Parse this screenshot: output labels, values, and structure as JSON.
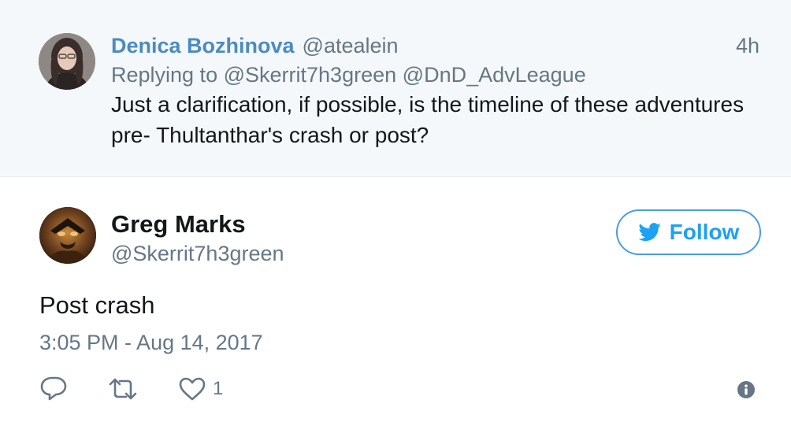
{
  "parent_tweet": {
    "author_name": "Denica Bozhinova",
    "author_handle": "@atealein",
    "time_ago": "4h",
    "replying_label": "Replying to",
    "replying_to": [
      "@Skerrit7h3green",
      "@DnD_AdvLeague"
    ],
    "text": "Just a clarification, if possible, is the timeline of these adventures pre- Thultanthar's crash or post?"
  },
  "main_tweet": {
    "author_name": "Greg Marks",
    "author_handle": "@Skerrit7h3green",
    "follow_label": "Follow",
    "text": "Post crash",
    "timestamp": "3:05 PM - Aug 14, 2017",
    "like_count": "1"
  },
  "icons": {
    "reply": "reply-icon",
    "retweet": "retweet-icon",
    "like": "heart-icon",
    "info": "info-icon",
    "follow": "twitter-bird-icon"
  },
  "colors": {
    "link_blue": "#1da1f2",
    "name_blue": "#4a8bc2",
    "muted_gray": "#657786",
    "parent_bg": "#f5f8fa"
  }
}
